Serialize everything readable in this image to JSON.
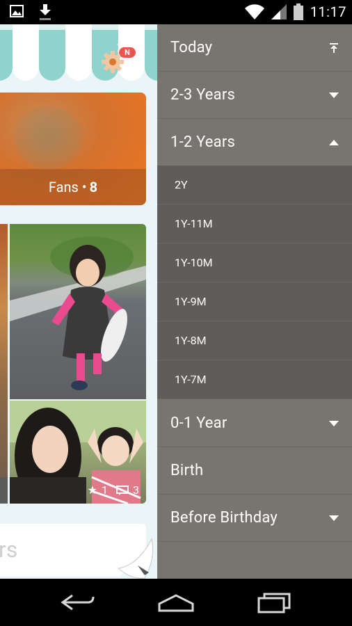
{
  "status_bar": {
    "time": "11:17",
    "icons_left": [
      "gallery-icon",
      "download-icon"
    ],
    "icons_right": [
      "wifi-icon",
      "signal-icon",
      "battery-icon"
    ]
  },
  "app": {
    "fans_label": "Fans •",
    "fans_count": "8",
    "notification_badge": "N",
    "photo_stats": {
      "stars": "1",
      "comments": "3"
    },
    "search_placeholder_fragment": "rs"
  },
  "drawer": {
    "items": [
      {
        "label": "Today",
        "icon": "scroll-to-top-icon"
      },
      {
        "label": "2-3 Years",
        "icon": "chevron-down-icon"
      },
      {
        "label": "1-2 Years",
        "icon": "chevron-up-icon",
        "expanded": true,
        "children": [
          "2Y",
          "1Y-11M",
          "1Y-10M",
          "1Y-9M",
          "1Y-8M",
          "1Y-7M"
        ]
      },
      {
        "label": "0-1 Year",
        "icon": "chevron-down-icon"
      },
      {
        "label": "Birth",
        "icon": ""
      },
      {
        "label": "Before Birthday",
        "icon": "chevron-down-icon"
      }
    ]
  },
  "nav_bar": {
    "buttons": [
      "back-button",
      "home-button",
      "recents-button"
    ]
  },
  "colors": {
    "drawer_bg": "#787470",
    "drawer_sub_bg": "#5f5c59",
    "awning_teal": "#8fd3cc",
    "badge_red": "#e9564e",
    "content_bg": "#e9f5f6"
  }
}
